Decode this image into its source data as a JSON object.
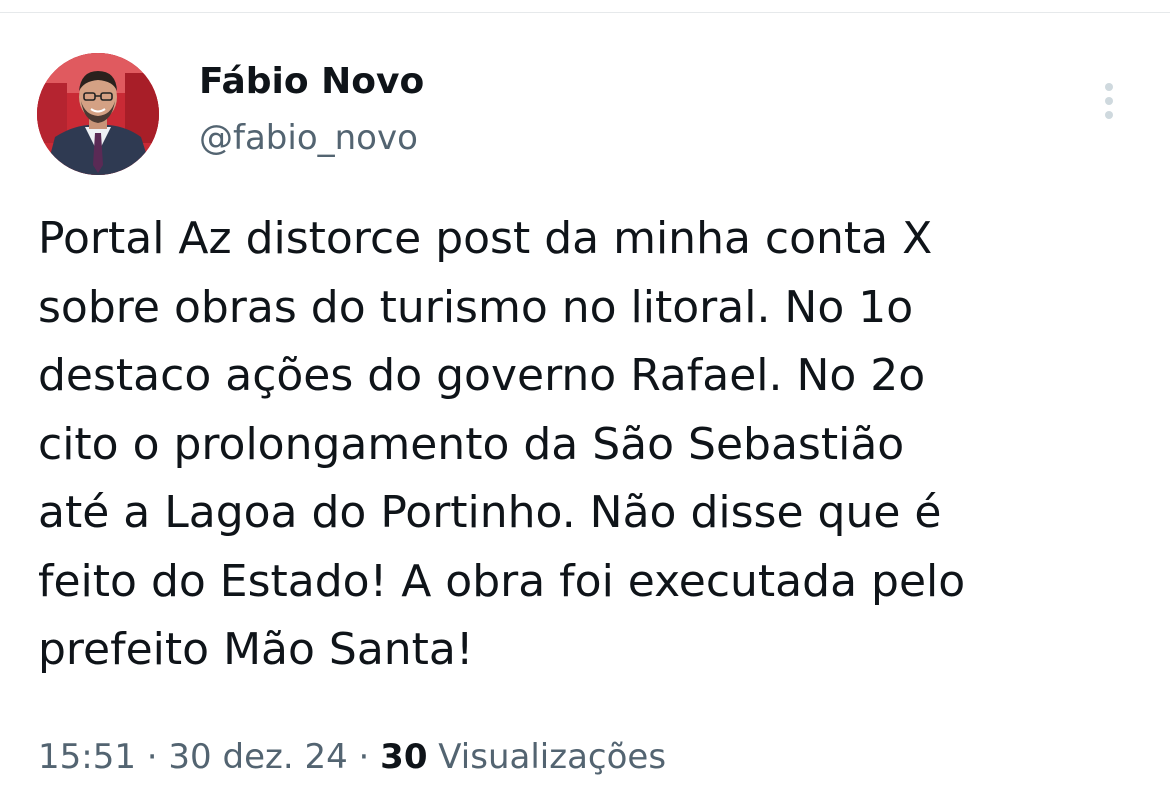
{
  "author": {
    "display_name": "Fábio Novo",
    "handle": "@fabio_novo",
    "avatar_icon": "profile-photo"
  },
  "tweet": {
    "lines": [
      "Portal Az distorce post da minha conta X",
      "sobre obras do turismo no litoral. No 1o",
      "destaco ações do governo Rafael. No 2o",
      "cito o prolongamento da São Sebastião",
      "até a Lagoa do Portinho. Não disse que é",
      "feito do Estado! A obra foi executada pelo",
      "prefeito Mão Santa!"
    ]
  },
  "meta": {
    "time": "15:51",
    "separator": " · ",
    "date": "30 dez. 24",
    "views_count": "30",
    "views_label": "Visualizações"
  },
  "menu": {
    "icon": "more-vertical-icon"
  },
  "colors": {
    "text_primary": "#0f1419",
    "text_secondary": "#536471",
    "background": "#ffffff"
  }
}
